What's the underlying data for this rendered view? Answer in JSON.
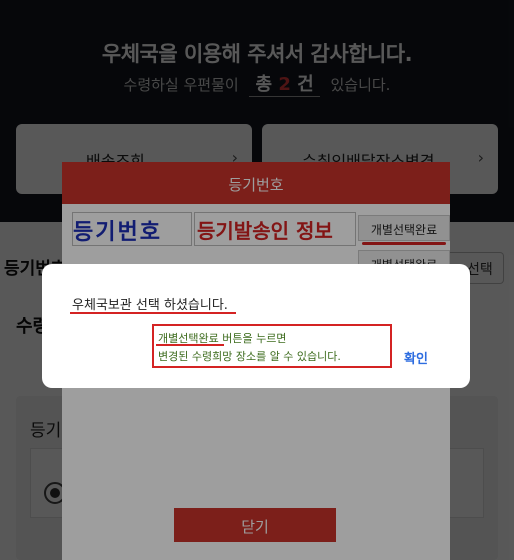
{
  "background": {
    "title": "우체국을 이용해 주셔서 감사합니다.",
    "subtitle_before": "수령하실 우편물이",
    "count_prefix": "총",
    "count": "2",
    "count_suffix": "건",
    "subtitle_after": "있습니다.",
    "buttons": [
      {
        "label": "배송조회"
      },
      {
        "label": "수취인배달장소변경"
      }
    ],
    "chevron": "›",
    "section_title": "등기번호",
    "section_button": "선택",
    "label_1": "수령",
    "label_2": "등기"
  },
  "registered_modal": {
    "title": "등기번호",
    "rows": [
      {
        "number_label": "등기번호",
        "sender_label": "등기발송인 정보",
        "button": "개별선택완료"
      },
      {
        "button": "개별선택완료"
      }
    ],
    "close_button": "닫기"
  },
  "alert": {
    "message": "우체국보관 선택 하셨습니다.",
    "note_line_1": "개별선택완료 버튼을 누르면",
    "note_line_2": "변경된 수령희망 장소를 알 수 있습니다.",
    "confirm_button": "확인"
  },
  "colors": {
    "accent_red": "#c8332b",
    "link_blue": "#2e6de0",
    "note_green": "#3c6b1c"
  }
}
